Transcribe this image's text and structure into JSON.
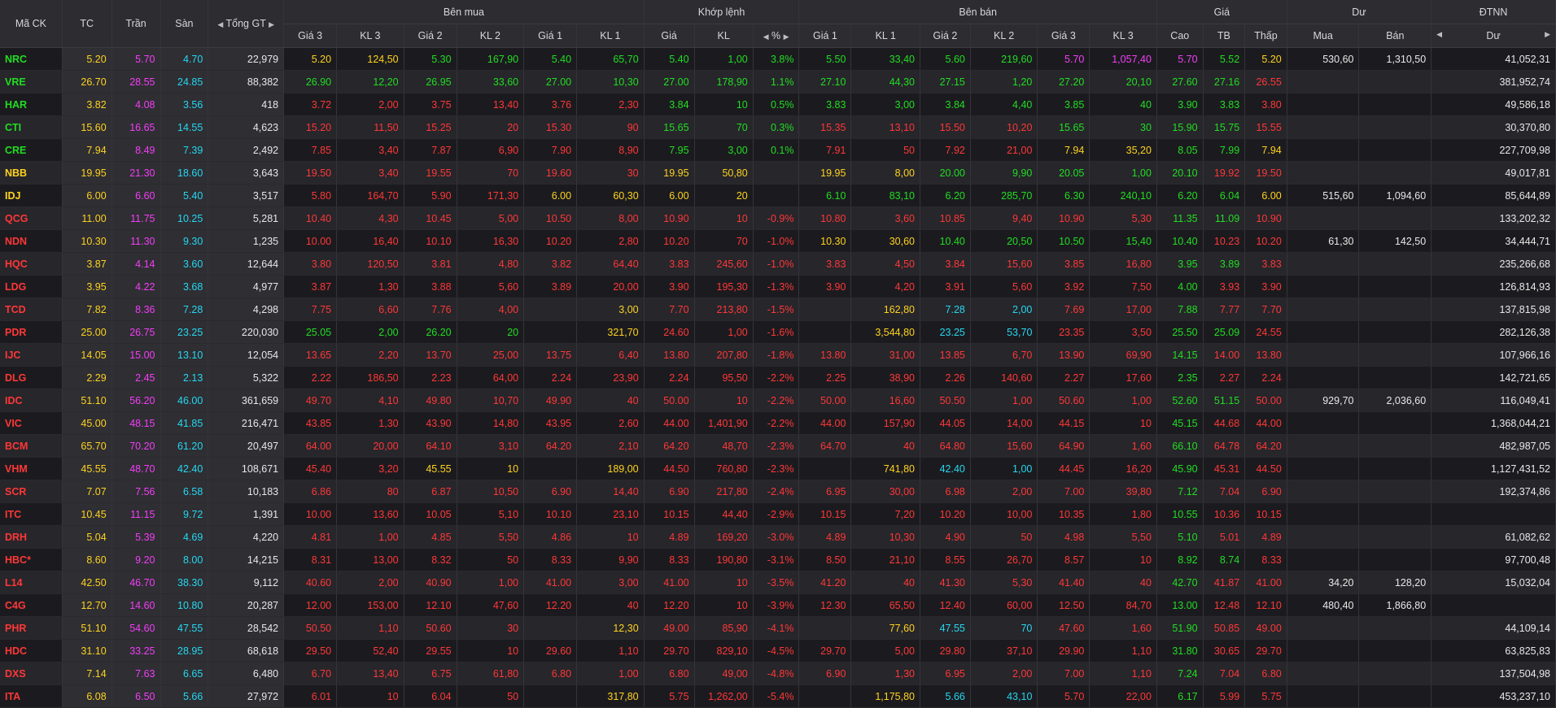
{
  "colors": {
    "green": "#22dd22",
    "red": "#ff3737",
    "yellow": "#ffd21f",
    "purple": "#f33ef5",
    "cyan": "#27d7f0",
    "white": "#e8e8e8"
  },
  "icons": {
    "left": "caret-left-icon",
    "right": "caret-right-icon",
    "sort": "sort-down-icon"
  },
  "headers": {
    "symbol": "Mã CK",
    "ref": "TC",
    "ceiling": "Trần",
    "floor": "Sàn",
    "total": "Tổng GT",
    "buy": "Bên mua",
    "match": "Khớp lệnh",
    "sell": "Bên bán",
    "price": "Giá",
    "remain": "Dư",
    "foreign": "ĐTNN",
    "buy_cols": [
      "Giá 3",
      "KL 3",
      "Giá 2",
      "KL 2",
      "Giá 1",
      "KL 1"
    ],
    "match_cols": [
      "Giá",
      "KL",
      "%"
    ],
    "sell_cols": [
      "Giá 1",
      "KL 1",
      "Giá 2",
      "KL 2",
      "Giá 3",
      "KL 3"
    ],
    "price_cols": [
      "Cao",
      "TB",
      "Thấp"
    ],
    "remain_cols": [
      "Mua",
      "Bán"
    ],
    "foreign_cols": [
      "Dư"
    ]
  },
  "rows": [
    {
      "sym": "NRC",
      "tc": "5.20",
      "tran": "5.70",
      "san": "4.70",
      "total": "22,979",
      "b3": "5.20",
      "bk3": "124,50",
      "b2": "5.30",
      "bk2": "167,90",
      "b1": "5.40",
      "bk1": "65,70",
      "mp": "5.40",
      "mk": "1,00",
      "pct": "3.8%",
      "s1": "5.50",
      "sk1": "33,40",
      "s2": "5.60",
      "sk2": "219,60",
      "s3": "5.70",
      "sk3": "1,057,40",
      "hi": "5.70",
      "avg": "5.52",
      "lo": "5.20",
      "dm": "530,60",
      "db": "1,310,50",
      "fr": "41,052,31"
    },
    {
      "sym": "VRE",
      "tc": "26.70",
      "tran": "28.55",
      "san": "24.85",
      "total": "88,382",
      "b3": "26.90",
      "bk3": "12,20",
      "b2": "26.95",
      "bk2": "33,60",
      "b1": "27.00",
      "bk1": "10,30",
      "mp": "27.00",
      "mk": "178,90",
      "pct": "1.1%",
      "s1": "27.10",
      "sk1": "44,30",
      "s2": "27.15",
      "sk2": "1,20",
      "s3": "27.20",
      "sk3": "20,10",
      "hi": "27.60",
      "avg": "27.16",
      "lo": "26.55",
      "dm": "",
      "db": "",
      "fr": "381,952,74"
    },
    {
      "sym": "HAR",
      "tc": "3.82",
      "tran": "4.08",
      "san": "3.56",
      "total": "418",
      "b3": "3.72",
      "bk3": "2,00",
      "b2": "3.75",
      "bk2": "13,40",
      "b1": "3.76",
      "bk1": "2,30",
      "mp": "3.84",
      "mk": "10",
      "pct": "0.5%",
      "s1": "3.83",
      "sk1": "3,00",
      "s2": "3.84",
      "sk2": "4,40",
      "s3": "3.85",
      "sk3": "40",
      "hi": "3.90",
      "avg": "3.83",
      "lo": "3.80",
      "dm": "",
      "db": "",
      "fr": "49,586,18"
    },
    {
      "sym": "CTI",
      "tc": "15.60",
      "tran": "16.65",
      "san": "14.55",
      "total": "4,623",
      "b3": "15.20",
      "bk3": "11,50",
      "b2": "15.25",
      "bk2": "20",
      "b1": "15.30",
      "bk1": "90",
      "mp": "15.65",
      "mk": "70",
      "pct": "0.3%",
      "s1": "15.35",
      "sk1": "13,10",
      "s2": "15.50",
      "sk2": "10,20",
      "s3": "15.65",
      "sk3": "30",
      "hi": "15.90",
      "avg": "15.75",
      "lo": "15.55",
      "dm": "",
      "db": "",
      "fr": "30,370,80"
    },
    {
      "sym": "CRE",
      "tc": "7.94",
      "tran": "8.49",
      "san": "7.39",
      "total": "2,492",
      "b3": "7.85",
      "bk3": "3,40",
      "b2": "7.87",
      "bk2": "6,90",
      "b1": "7.90",
      "bk1": "8,90",
      "mp": "7.95",
      "mk": "3,00",
      "pct": "0.1%",
      "s1": "7.91",
      "sk1": "50",
      "s2": "7.92",
      "sk2": "21,00",
      "s3": "7.94",
      "sk3": "35,20",
      "hi": "8.05",
      "avg": "7.99",
      "lo": "7.94",
      "dm": "",
      "db": "",
      "fr": "227,709,98"
    },
    {
      "sym": "NBB",
      "tc": "19.95",
      "tran": "21.30",
      "san": "18.60",
      "total": "3,643",
      "b3": "19.50",
      "bk3": "3,40",
      "b2": "19.55",
      "bk2": "70",
      "b1": "19.60",
      "bk1": "30",
      "mp": "19.95",
      "mk": "50,80",
      "pct": "",
      "s1": "19.95",
      "sk1": "8,00",
      "s2": "20.00",
      "sk2": "9,90",
      "s3": "20.05",
      "sk3": "1,00",
      "hi": "20.10",
      "avg": "19.92",
      "lo": "19.50",
      "dm": "",
      "db": "",
      "fr": "49,017,81"
    },
    {
      "sym": "IDJ",
      "tc": "6.00",
      "tran": "6.60",
      "san": "5.40",
      "total": "3,517",
      "b3": "5.80",
      "bk3": "164,70",
      "b2": "5.90",
      "bk2": "171,30",
      "b1": "6.00",
      "bk1": "60,30",
      "mp": "6.00",
      "mk": "20",
      "pct": "",
      "s1": "6.10",
      "sk1": "83,10",
      "s2": "6.20",
      "sk2": "285,70",
      "s3": "6.30",
      "sk3": "240,10",
      "hi": "6.20",
      "avg": "6.04",
      "lo": "6.00",
      "dm": "515,60",
      "db": "1,094,60",
      "fr": "85,644,89"
    },
    {
      "sym": "QCG",
      "tc": "11.00",
      "tran": "11.75",
      "san": "10.25",
      "total": "5,281",
      "b3": "10.40",
      "bk3": "4,30",
      "b2": "10.45",
      "bk2": "5,00",
      "b1": "10.50",
      "bk1": "8,00",
      "mp": "10.90",
      "mk": "10",
      "pct": "-0.9%",
      "s1": "10.80",
      "sk1": "3,60",
      "s2": "10.85",
      "sk2": "9,40",
      "s3": "10.90",
      "sk3": "5,30",
      "hi": "11.35",
      "avg": "11.09",
      "lo": "10.90",
      "dm": "",
      "db": "",
      "fr": "133,202,32"
    },
    {
      "sym": "NDN",
      "tc": "10.30",
      "tran": "11.30",
      "san": "9.30",
      "total": "1,235",
      "b3": "10.00",
      "bk3": "16,40",
      "b2": "10.10",
      "bk2": "16,30",
      "b1": "10.20",
      "bk1": "2,80",
      "mp": "10.20",
      "mk": "70",
      "pct": "-1.0%",
      "s1": "10.30",
      "sk1": "30,60",
      "s2": "10.40",
      "sk2": "20,50",
      "s3": "10.50",
      "sk3": "15,40",
      "hi": "10.40",
      "avg": "10.23",
      "lo": "10.20",
      "dm": "61,30",
      "db": "142,50",
      "fr": "34,444,71"
    },
    {
      "sym": "HQC",
      "tc": "3.87",
      "tran": "4.14",
      "san": "3.60",
      "total": "12,644",
      "b3": "3.80",
      "bk3": "120,50",
      "b2": "3.81",
      "bk2": "4,80",
      "b1": "3.82",
      "bk1": "64,40",
      "mp": "3.83",
      "mk": "245,60",
      "pct": "-1.0%",
      "s1": "3.83",
      "sk1": "4,50",
      "s2": "3.84",
      "sk2": "15,60",
      "s3": "3.85",
      "sk3": "16,80",
      "hi": "3.95",
      "avg": "3.89",
      "lo": "3.83",
      "dm": "",
      "db": "",
      "fr": "235,266,68"
    },
    {
      "sym": "LDG",
      "tc": "3.95",
      "tran": "4.22",
      "san": "3.68",
      "total": "4,977",
      "b3": "3.87",
      "bk3": "1,30",
      "b2": "3.88",
      "bk2": "5,60",
      "b1": "3.89",
      "bk1": "20,00",
      "mp": "3.90",
      "mk": "195,30",
      "pct": "-1.3%",
      "s1": "3.90",
      "sk1": "4,20",
      "s2": "3.91",
      "sk2": "5,60",
      "s3": "3.92",
      "sk3": "7,50",
      "hi": "4.00",
      "avg": "3.93",
      "lo": "3.90",
      "dm": "",
      "db": "",
      "fr": "126,814,93"
    },
    {
      "sym": "TCD",
      "tc": "7.82",
      "tran": "8.36",
      "san": "7.28",
      "total": "4,298",
      "b3": "7.75",
      "bk3": "6,60",
      "b2": "7.76",
      "bk2": "4,00",
      "b1": "",
      "bk1": "3,00",
      "mp": "7.70",
      "mk": "213,80",
      "pct": "-1.5%",
      "s1": "",
      "sk1": "162,80",
      "s2": "7.28",
      "sk2": "2,00",
      "s3": "7.69",
      "sk3": "17,00",
      "hi": "7.88",
      "avg": "7.77",
      "lo": "7.70",
      "dm": "",
      "db": "",
      "fr": "137,815,98"
    },
    {
      "sym": "PDR",
      "tc": "25.00",
      "tran": "26.75",
      "san": "23.25",
      "total": "220,030",
      "b3": "25.05",
      "bk3": "2,00",
      "b2": "26.20",
      "bk2": "20",
      "b1": "",
      "bk1": "321,70",
      "mp": "24.60",
      "mk": "1,00",
      "pct": "-1.6%",
      "s1": "",
      "sk1": "3,544,80",
      "s2": "23.25",
      "sk2": "53,70",
      "s3": "23.35",
      "sk3": "3,50",
      "hi": "25.50",
      "avg": "25.09",
      "lo": "24.55",
      "dm": "",
      "db": "",
      "fr": "282,126,38"
    },
    {
      "sym": "IJC",
      "tc": "14.05",
      "tran": "15.00",
      "san": "13.10",
      "total": "12,054",
      "b3": "13.65",
      "bk3": "2,20",
      "b2": "13.70",
      "bk2": "25,00",
      "b1": "13.75",
      "bk1": "6,40",
      "mp": "13.80",
      "mk": "207,80",
      "pct": "-1.8%",
      "s1": "13.80",
      "sk1": "31,00",
      "s2": "13.85",
      "sk2": "6,70",
      "s3": "13.90",
      "sk3": "69,90",
      "hi": "14.15",
      "avg": "14.00",
      "lo": "13.80",
      "dm": "",
      "db": "",
      "fr": "107,966,16"
    },
    {
      "sym": "DLG",
      "tc": "2.29",
      "tran": "2.45",
      "san": "2.13",
      "total": "5,322",
      "b3": "2.22",
      "bk3": "186,50",
      "b2": "2.23",
      "bk2": "64,00",
      "b1": "2.24",
      "bk1": "23,90",
      "mp": "2.24",
      "mk": "95,50",
      "pct": "-2.2%",
      "s1": "2.25",
      "sk1": "38,90",
      "s2": "2.26",
      "sk2": "140,60",
      "s3": "2.27",
      "sk3": "17,60",
      "hi": "2.35",
      "avg": "2.27",
      "lo": "2.24",
      "dm": "",
      "db": "",
      "fr": "142,721,65"
    },
    {
      "sym": "IDC",
      "tc": "51.10",
      "tran": "56.20",
      "san": "46.00",
      "total": "361,659",
      "b3": "49.70",
      "bk3": "4,10",
      "b2": "49.80",
      "bk2": "10,70",
      "b1": "49.90",
      "bk1": "40",
      "mp": "50.00",
      "mk": "10",
      "pct": "-2.2%",
      "s1": "50.00",
      "sk1": "16,60",
      "s2": "50.50",
      "sk2": "1,00",
      "s3": "50.60",
      "sk3": "1,00",
      "hi": "52.60",
      "avg": "51.15",
      "lo": "50.00",
      "dm": "929,70",
      "db": "2,036,60",
      "fr": "116,049,41"
    },
    {
      "sym": "VIC",
      "tc": "45.00",
      "tran": "48.15",
      "san": "41.85",
      "total": "216,471",
      "b3": "43.85",
      "bk3": "1,30",
      "b2": "43.90",
      "bk2": "14,80",
      "b1": "43.95",
      "bk1": "2,60",
      "mp": "44.00",
      "mk": "1,401,90",
      "pct": "-2.2%",
      "s1": "44.00",
      "sk1": "157,90",
      "s2": "44.05",
      "sk2": "14,00",
      "s3": "44.15",
      "sk3": "10",
      "hi": "45.15",
      "avg": "44.68",
      "lo": "44.00",
      "dm": "",
      "db": "",
      "fr": "1,368,044,21"
    },
    {
      "sym": "BCM",
      "tc": "65.70",
      "tran": "70.20",
      "san": "61.20",
      "total": "20,497",
      "b3": "64.00",
      "bk3": "20,00",
      "b2": "64.10",
      "bk2": "3,10",
      "b1": "64.20",
      "bk1": "2,10",
      "mp": "64.20",
      "mk": "48,70",
      "pct": "-2.3%",
      "s1": "64.70",
      "sk1": "40",
      "s2": "64.80",
      "sk2": "15,60",
      "s3": "64.90",
      "sk3": "1,60",
      "hi": "66.10",
      "avg": "64.78",
      "lo": "64.20",
      "dm": "",
      "db": "",
      "fr": "482,987,05"
    },
    {
      "sym": "VHM",
      "tc": "45.55",
      "tran": "48.70",
      "san": "42.40",
      "total": "108,671",
      "b3": "45.40",
      "bk3": "3,20",
      "b2": "45.55",
      "bk2": "10",
      "b1": "",
      "bk1": "189,00",
      "mp": "44.50",
      "mk": "760,80",
      "pct": "-2.3%",
      "s1": "",
      "sk1": "741,80",
      "s2": "42.40",
      "sk2": "1,00",
      "s3": "44.45",
      "sk3": "16,20",
      "hi": "45.90",
      "avg": "45.31",
      "lo": "44.50",
      "dm": "",
      "db": "",
      "fr": "1,127,431,52"
    },
    {
      "sym": "SCR",
      "tc": "7.07",
      "tran": "7.56",
      "san": "6.58",
      "total": "10,183",
      "b3": "6.86",
      "bk3": "80",
      "b2": "6.87",
      "bk2": "10,50",
      "b1": "6.90",
      "bk1": "14,40",
      "mp": "6.90",
      "mk": "217,80",
      "pct": "-2.4%",
      "s1": "6.95",
      "sk1": "30,00",
      "s2": "6.98",
      "sk2": "2,00",
      "s3": "7.00",
      "sk3": "39,80",
      "hi": "7.12",
      "avg": "7.04",
      "lo": "6.90",
      "dm": "",
      "db": "",
      "fr": "192,374,86"
    },
    {
      "sym": "ITC",
      "tc": "10.45",
      "tran": "11.15",
      "san": "9.72",
      "total": "1,391",
      "b3": "10.00",
      "bk3": "13,60",
      "b2": "10.05",
      "bk2": "5,10",
      "b1": "10.10",
      "bk1": "23,10",
      "mp": "10.15",
      "mk": "44,40",
      "pct": "-2.9%",
      "s1": "10.15",
      "sk1": "7,20",
      "s2": "10.20",
      "sk2": "10,00",
      "s3": "10.35",
      "sk3": "1,80",
      "hi": "10.55",
      "avg": "10.36",
      "lo": "10.15",
      "dm": "",
      "db": "",
      "fr": ""
    },
    {
      "sym": "DRH",
      "tc": "5.04",
      "tran": "5.39",
      "san": "4.69",
      "total": "4,220",
      "b3": "4.81",
      "bk3": "1,00",
      "b2": "4.85",
      "bk2": "5,50",
      "b1": "4.86",
      "bk1": "10",
      "mp": "4.89",
      "mk": "169,20",
      "pct": "-3.0%",
      "s1": "4.89",
      "sk1": "10,30",
      "s2": "4.90",
      "sk2": "50",
      "s3": "4.98",
      "sk3": "5,50",
      "hi": "5.10",
      "avg": "5.01",
      "lo": "4.89",
      "dm": "",
      "db": "",
      "fr": "61,082,62"
    },
    {
      "sym": "HBC*",
      "tc": "8.60",
      "tran": "9.20",
      "san": "8.00",
      "total": "14,215",
      "b3": "8.31",
      "bk3": "13,00",
      "b2": "8.32",
      "bk2": "50",
      "b1": "8.33",
      "bk1": "9,90",
      "mp": "8.33",
      "mk": "190,80",
      "pct": "-3.1%",
      "s1": "8.50",
      "sk1": "21,10",
      "s2": "8.55",
      "sk2": "26,70",
      "s3": "8.57",
      "sk3": "10",
      "hi": "8.92",
      "avg": "8.74",
      "lo": "8.33",
      "dm": "",
      "db": "",
      "fr": "97,700,48"
    },
    {
      "sym": "L14",
      "tc": "42.50",
      "tran": "46.70",
      "san": "38.30",
      "total": "9,112",
      "b3": "40.60",
      "bk3": "2,00",
      "b2": "40.90",
      "bk2": "1,00",
      "b1": "41.00",
      "bk1": "3,00",
      "mp": "41.00",
      "mk": "10",
      "pct": "-3.5%",
      "s1": "41.20",
      "sk1": "40",
      "s2": "41.30",
      "sk2": "5,30",
      "s3": "41.40",
      "sk3": "40",
      "hi": "42.70",
      "avg": "41.87",
      "lo": "41.00",
      "dm": "34,20",
      "db": "128,20",
      "fr": "15,032,04"
    },
    {
      "sym": "C4G",
      "tc": "12.70",
      "tran": "14.60",
      "san": "10.80",
      "total": "20,287",
      "b3": "12.00",
      "bk3": "153,00",
      "b2": "12.10",
      "bk2": "47,60",
      "b1": "12.20",
      "bk1": "40",
      "mp": "12.20",
      "mk": "10",
      "pct": "-3.9%",
      "s1": "12.30",
      "sk1": "65,50",
      "s2": "12.40",
      "sk2": "60,00",
      "s3": "12.50",
      "sk3": "84,70",
      "hi": "13.00",
      "avg": "12.48",
      "lo": "12.10",
      "dm": "480,40",
      "db": "1,866,80",
      "fr": ""
    },
    {
      "sym": "PHR",
      "tc": "51.10",
      "tran": "54.60",
      "san": "47.55",
      "total": "28,542",
      "b3": "50.50",
      "bk3": "1,10",
      "b2": "50.60",
      "bk2": "30",
      "b1": "",
      "bk1": "12,30",
      "mp": "49.00",
      "mk": "85,90",
      "pct": "-4.1%",
      "s1": "",
      "sk1": "77,60",
      "s2": "47.55",
      "sk2": "70",
      "s3": "47.60",
      "sk3": "1,60",
      "hi": "51.90",
      "avg": "50.85",
      "lo": "49.00",
      "dm": "",
      "db": "",
      "fr": "44,109,14"
    },
    {
      "sym": "HDC",
      "tc": "31.10",
      "tran": "33.25",
      "san": "28.95",
      "total": "68,618",
      "b3": "29.50",
      "bk3": "52,40",
      "b2": "29.55",
      "bk2": "10",
      "b1": "29.60",
      "bk1": "1,10",
      "mp": "29.70",
      "mk": "829,10",
      "pct": "-4.5%",
      "s1": "29.70",
      "sk1": "5,00",
      "s2": "29.80",
      "sk2": "37,10",
      "s3": "29.90",
      "sk3": "1,10",
      "hi": "31.80",
      "avg": "30.65",
      "lo": "29.70",
      "dm": "",
      "db": "",
      "fr": "63,825,83"
    },
    {
      "sym": "DXS",
      "tc": "7.14",
      "tran": "7.63",
      "san": "6.65",
      "total": "6,480",
      "b3": "6.70",
      "bk3": "13,40",
      "b2": "6.75",
      "bk2": "61,80",
      "b1": "6.80",
      "bk1": "1,00",
      "mp": "6.80",
      "mk": "49,00",
      "pct": "-4.8%",
      "s1": "6.90",
      "sk1": "1,30",
      "s2": "6.95",
      "sk2": "2,00",
      "s3": "7.00",
      "sk3": "1,10",
      "hi": "7.24",
      "avg": "7.04",
      "lo": "6.80",
      "dm": "",
      "db": "",
      "fr": "137,504,98"
    },
    {
      "sym": "ITA",
      "tc": "6.08",
      "tran": "6.50",
      "san": "5.66",
      "total": "27,972",
      "b3": "6.01",
      "bk3": "10",
      "b2": "6.04",
      "bk2": "50",
      "b1": "",
      "bk1": "317,80",
      "mp": "5.75",
      "mk": "1,262,00",
      "pct": "-5.4%",
      "s1": "",
      "sk1": "1,175,80",
      "s2": "5.66",
      "sk2": "43,10",
      "s3": "5.70",
      "sk3": "22,00",
      "hi": "6.17",
      "avg": "5.99",
      "lo": "5.75",
      "dm": "",
      "db": "",
      "fr": "453,237,10"
    }
  ]
}
